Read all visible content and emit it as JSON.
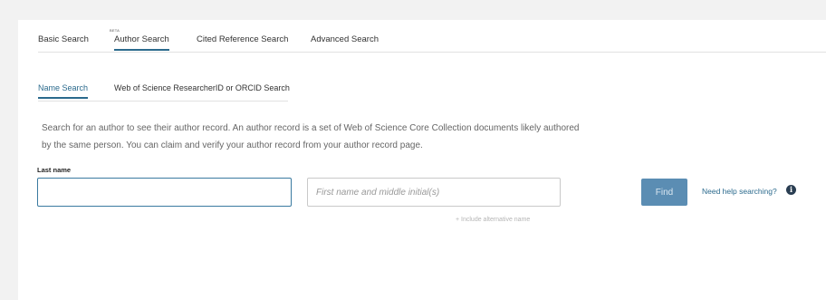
{
  "tabs": {
    "basic": "Basic Search",
    "author": "Author Search",
    "author_badge": "BETA",
    "cited": "Cited Reference Search",
    "advanced": "Advanced Search"
  },
  "subtabs": {
    "name": "Name Search",
    "researcher_id": "Web of Science ResearcherID or ORCID Search"
  },
  "description": "Search for an author to see their author record. An author record is a set of Web of Science Core Collection documents likely authored by the same person. You can claim and verify your author record from your author record page.",
  "form": {
    "last_name_label": "Last name",
    "last_name_value": "",
    "first_name_placeholder": "First name and middle initial(s)",
    "alternative_name_link": "+ Include alternative name",
    "find_button": "Find",
    "help_link": "Need help searching?"
  },
  "colors": {
    "accent": "#2b6a8d",
    "find_button": "#5b8db3"
  },
  "icons": {
    "help": "info-icon"
  }
}
